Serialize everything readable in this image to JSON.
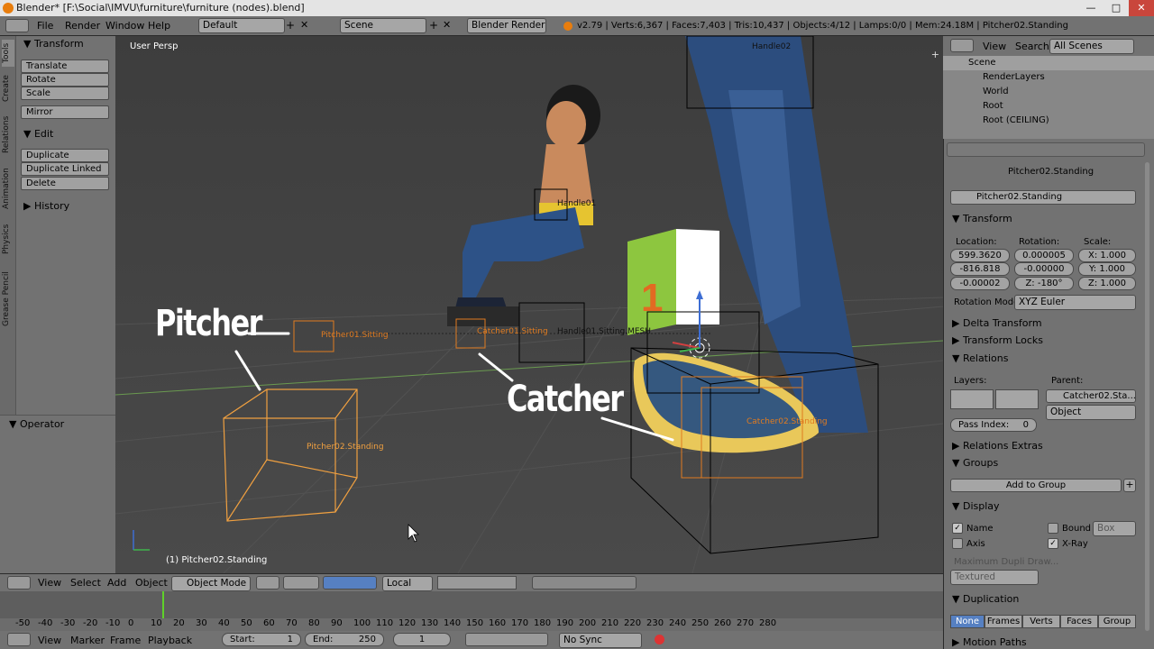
{
  "title": "Blender* [F:\\Social\\IMVU\\furniture\\furniture (nodes).blend]",
  "window_controls": [
    "—",
    "□",
    "✕"
  ],
  "menus": [
    "File",
    "Render",
    "Window",
    "Help"
  ],
  "layout": "Default",
  "scene": "Scene",
  "engine": "Blender Render",
  "stats": "v2.79 | Verts:6,367 | Faces:7,403 | Tris:10,437 | Objects:4/12 | Lamps:0/0 | Mem:24.18M | Pitcher02.Standing",
  "left_tabs": [
    "Tools",
    "Create",
    "Relations",
    "Animation",
    "Physics",
    "Grease Pencil"
  ],
  "tools": {
    "transform": "Transform",
    "translate": "Translate",
    "rotate": "Rotate",
    "scale": "Scale",
    "mirror": "Mirror",
    "edit": "Edit",
    "duplicate": "Duplicate",
    "duplicate_linked": "Duplicate Linked",
    "delete": "Delete",
    "history": "History",
    "operator": "Operator"
  },
  "viewport": {
    "persp": "User Persp",
    "selected": "(1) Pitcher02.Standing",
    "label_pitcher": "Pitcher",
    "label_catcher": "Catcher",
    "obj": {
      "handle02": "Handle02",
      "handle01": "Handle01",
      "pitcher01": "Pitcher01.Sitting",
      "catcher01": "Catcher01.Sitting",
      "mesh": "Handle01.Sitting.MESH",
      "catcher02": "Catcher02.Standing",
      "pitcher02": "Pitcher02.Standing",
      "seat": "1"
    }
  },
  "header3d": {
    "view": "View",
    "select": "Select",
    "add": "Add",
    "object": "Object",
    "mode": "Object Mode",
    "orient": "Local"
  },
  "timeline": {
    "ticks": [
      "-50",
      "-40",
      "-30",
      "-20",
      "-10",
      "0",
      "10",
      "20",
      "30",
      "40",
      "50",
      "60",
      "70",
      "80",
      "90",
      "100",
      "110",
      "120",
      "130",
      "140",
      "150",
      "160",
      "170",
      "180",
      "190",
      "200",
      "210",
      "220",
      "230",
      "240",
      "250",
      "260",
      "270",
      "280"
    ],
    "view": "View",
    "marker": "Marker",
    "frame": "Frame",
    "playback": "Playback",
    "start_label": "Start:",
    "start": "1",
    "end_label": "End:",
    "end": "250",
    "current": "1",
    "sync": "No Sync"
  },
  "outliner": {
    "view": "View",
    "search": "Search",
    "filter": "All Scenes",
    "items": [
      "Scene",
      "RenderLayers",
      "World",
      "Root",
      "Root (CEILING)"
    ]
  },
  "props": {
    "breadcrumb": "Pitcher02.Standing",
    "name": "Pitcher02.Standing",
    "transform": "Transform",
    "location": "Location:",
    "rotation": "Rotation:",
    "scale": "Scale:",
    "loc": [
      "599.3620",
      "-816.818",
      "-0.00002"
    ],
    "rot": [
      "0.000005",
      "-0.00000",
      "Z:  -180°"
    ],
    "scl": [
      "X:  1.000",
      "Y:  1.000",
      "Z:  1.000"
    ],
    "rotation_mode_label": "Rotation Mode:",
    "rotation_mode": "XYZ Euler",
    "delta": "Delta Transform",
    "locks": "Transform Locks",
    "relations": "Relations",
    "layers": "Layers:",
    "parent": "Parent:",
    "parent_val": "Catcher02.Sta...",
    "parent_type": "Object",
    "pass_index": "Pass Index:",
    "pass_val": "0",
    "relations_extras": "Relations Extras",
    "groups": "Groups",
    "add_to_group": "Add to Group",
    "display": "Display",
    "name_cb": "Name",
    "axis_cb": "Axis",
    "bound_cb": "Bound",
    "bound_type": "Box",
    "xray_cb": "X-Ray",
    "max_dupli": "Maximum Dupli Draw...",
    "textured": "Textured",
    "duplication": "Duplication",
    "dup_tabs": [
      "None",
      "Frames",
      "Verts",
      "Faces",
      "Group"
    ],
    "motion_paths": "Motion Paths"
  }
}
